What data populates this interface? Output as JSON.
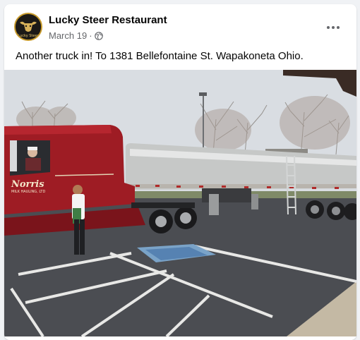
{
  "post": {
    "page_name": "Lucky Steer Restaurant",
    "date": "March 19",
    "dot": "·",
    "text": "Another truck in! To 1381 Bellefontaine St. Wapakoneta Ohio.",
    "avatar_text": "Lucky Steer",
    "privacy_icon": "globe-icon",
    "more_icon": "more-options-icon"
  },
  "photo": {
    "cab_lettering_1": "Norris",
    "cab_lettering_2": "MILK HAULING, LTD",
    "colors": {
      "cab": "#9e1c24",
      "tank": "#c6c8c7",
      "parking_lot": "#4b4d52",
      "sky": "#d9dde2",
      "sidewalk": "#c4b9a4"
    }
  }
}
